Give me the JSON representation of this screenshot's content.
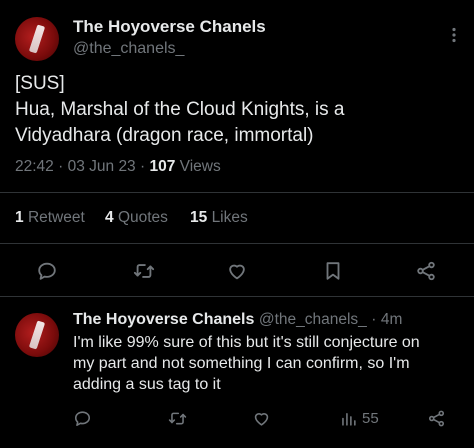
{
  "tweet": {
    "author_name": "The Hoyoverse Chanels",
    "author_handle": "@the_chanels_",
    "text_line1": "[SUS]",
    "text_line2": "Hua, Marshal of the Cloud Knights, is a",
    "text_line3": "Vidyadhara (dragon race, immortal)",
    "time": "22:42",
    "date": "03 Jun 23",
    "views_count": "107",
    "views_label": "Views",
    "retweets_count": "1",
    "retweets_label": "Retweet",
    "quotes_count": "4",
    "quotes_label": "Quotes",
    "likes_count": "15",
    "likes_label": "Likes",
    "sep": "·",
    "actions": [
      "reply-icon",
      "retweet-icon",
      "like-icon",
      "bookmark-icon",
      "share-icon"
    ]
  },
  "reply": {
    "author_name": "The Hoyoverse Chanels",
    "author_handle": "@the_chanels_",
    "sep": "·",
    "time": "4m",
    "text_line1": "I'm like 99% sure of this but it's still conjecture on",
    "text_line2": "my part and not something I can confirm, so I'm",
    "text_line3": "adding a sus tag to it",
    "views": "55",
    "actions": [
      "reply-icon",
      "retweet-icon",
      "like-icon",
      "views-icon",
      "share-icon"
    ]
  },
  "colors": {
    "background": "#000000",
    "text_primary": "#e7e9ea",
    "text_secondary": "#71767b",
    "divider": "#2f3336",
    "avatar_red": "#9b1414"
  }
}
